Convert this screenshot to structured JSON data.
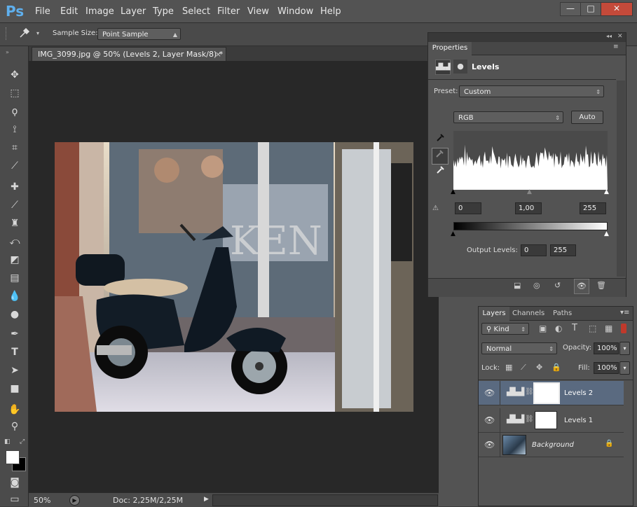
{
  "app": {
    "logo": "Ps",
    "menu": [
      "File",
      "Edit",
      "Image",
      "Layer",
      "Type",
      "Select",
      "Filter",
      "View",
      "Window",
      "Help"
    ],
    "window_controls": [
      "—",
      "□",
      "✕"
    ]
  },
  "options": {
    "sample_size_label": "Sample Size:",
    "sample_size_value": "Point Sample"
  },
  "document": {
    "tab_title": "IMG_3099.jpg @ 50% (Levels 2, Layer Mask/8) *",
    "tab_close": "×",
    "zoom": "50%",
    "doc_info": "Doc: 2,25M/2,25M",
    "photo_sign_text": "KEN"
  },
  "properties": {
    "panel_title": "Properties",
    "adjustment_name": "Levels",
    "preset_label": "Preset:",
    "preset_value": "Custom",
    "channel_value": "RGB",
    "auto_label": "Auto",
    "input_black": "0",
    "input_gamma": "1,00",
    "input_white": "255",
    "output_label": "Output Levels:",
    "output_black": "0",
    "output_white": "255"
  },
  "layers": {
    "tabs": [
      "Layers",
      "Channels",
      "Paths"
    ],
    "kind_label": "Kind",
    "blend_mode": "Normal",
    "opacity_label": "Opacity:",
    "opacity_value": "100%",
    "lock_label": "Lock:",
    "fill_label": "Fill:",
    "fill_value": "100%",
    "items": [
      {
        "name": "Levels 2",
        "selected": true
      },
      {
        "name": "Levels 1",
        "selected": false
      },
      {
        "name": "Background",
        "selected": false
      }
    ]
  },
  "colors": {
    "accent": "#5fb0ee",
    "selected_layer": "#5a6a80"
  }
}
